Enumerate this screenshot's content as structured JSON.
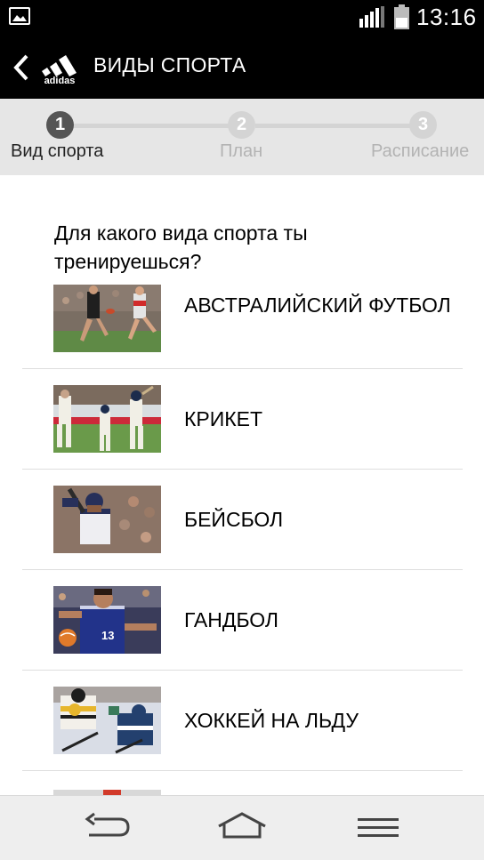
{
  "status_bar": {
    "time": "13:16",
    "icons": [
      "gallery-icon",
      "signal-icon",
      "battery-icon"
    ]
  },
  "action_bar": {
    "title": "ВИДЫ СПОРТА",
    "back_icon": "chevron-left-icon",
    "logo_text": "adidas"
  },
  "stepper": {
    "steps": [
      {
        "number": "1",
        "label": "Вид спорта",
        "state": "active"
      },
      {
        "number": "2",
        "label": "План",
        "state": "inactive"
      },
      {
        "number": "3",
        "label": "Расписание",
        "state": "inactive"
      }
    ]
  },
  "question": "Для какого вида спорта ты тренируешься?",
  "sports": [
    {
      "label": "АВСТРАЛИЙСКИЙ ФУТБОЛ",
      "icon": "australian-football-photo"
    },
    {
      "label": "КРИКЕТ",
      "icon": "cricket-photo"
    },
    {
      "label": "БЕЙСБОЛ",
      "icon": "baseball-photo"
    },
    {
      "label": "ГАНДБОЛ",
      "icon": "handball-photo"
    },
    {
      "label": "ХОККЕЙ НА ЛЬДУ",
      "icon": "ice-hockey-photo"
    }
  ],
  "nav_bar": {
    "buttons": [
      "back-icon",
      "home-icon",
      "menu-icon"
    ]
  },
  "colors": {
    "status_bar_bg": "#000000",
    "action_bar_bg": "#000000",
    "stepper_bg": "#e6e6e6",
    "step_active": "#555555",
    "step_inactive": "#d4d4d4",
    "nav_bar_bg": "#eeeeee"
  }
}
